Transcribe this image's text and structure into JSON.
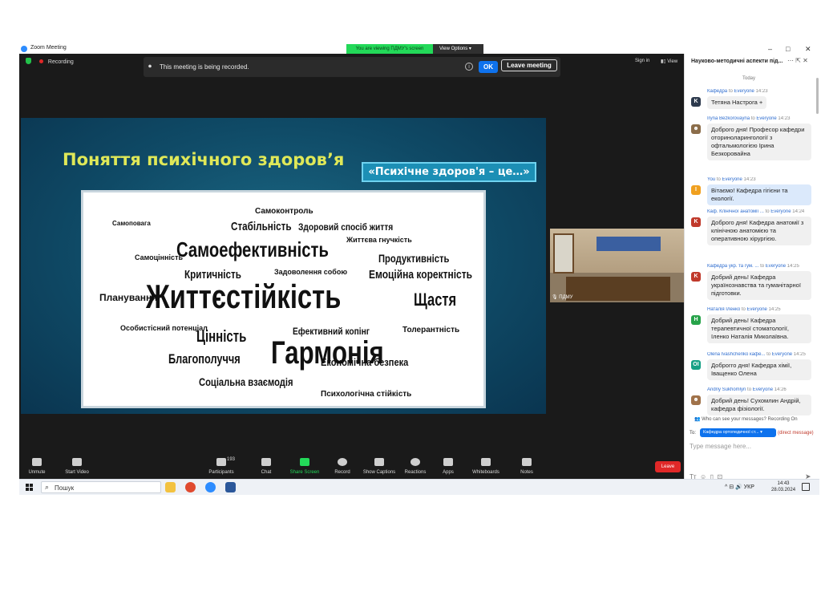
{
  "window": {
    "title": "Zoom Meeting",
    "viewing_banner": "You are viewing ПДМУ's screen",
    "view_options": "View Options",
    "controls": [
      "–",
      "□",
      "✕"
    ]
  },
  "top": {
    "recording": "Recording",
    "banner_text": "This meeting is being recorded.",
    "ok": "OK",
    "leave_meeting": "Leave meeting",
    "sign_in": "Sign in",
    "view": "View"
  },
  "slide": {
    "title": "Поняття психічного здоров’я",
    "box": "«Психічне здоров'я – це…»",
    "words": [
      "Життєстійкість",
      "Гармонія",
      "Самоефективність",
      "Щастя",
      "Цінність",
      "Благополуччя",
      "Самоконтроль",
      "Стабільність",
      "Продуктивність",
      "Емоційна коректність",
      "Критичність",
      "Соціальна взаємодія",
      "Економічна безпека",
      "Здоровий спосіб життя",
      "Ефективний копінг",
      "Толерантність",
      "Планування",
      "Психологічна стійкість",
      "Задоволення собою",
      "Самоцінність",
      "Особистісний потенціал",
      "Життєва гнучкість",
      "Самоповага"
    ]
  },
  "video": {
    "label": "ПДМУ"
  },
  "toolbar": {
    "unmute": "Unmute",
    "start_video": "Start Video",
    "participants": "Participants",
    "participants_count": "193",
    "chat": "Chat",
    "share_screen": "Share Screen",
    "record": "Record",
    "show_captions": "Show Captions",
    "reactions": "Reactions",
    "apps": "Apps",
    "whiteboards": "Whiteboards",
    "notes": "Notes",
    "leave": "Leave"
  },
  "chat": {
    "title": "Науково-методичні аспекти під...",
    "today": "Today",
    "messages": [
      {
        "from": "Кафедра",
        "to": "Everyone",
        "time": "14:23",
        "avatar": "K",
        "color": "#2d3a4d",
        "text": "Тетяна Настрога +"
      },
      {
        "from": "Iryna Bezkorovayna",
        "to": "Everyone",
        "time": "14:23",
        "avatar": "img",
        "color": "#8b6d4a",
        "text": "Доброго дня! Професор кафедри оториноларингології з офтальмологією Ірина Безкоровайна"
      },
      {
        "from": "You",
        "to": "Everyone",
        "time": "14:23",
        "avatar": "I",
        "color": "#f0a020",
        "text": "Вітаємо! Кафедра гігієни та екології."
      },
      {
        "from": "Каф. Клінічної анатомії ...",
        "to": "Everyone",
        "time": "14:24",
        "avatar": "K",
        "color": "#c0392b",
        "text": "Доброго дня! Кафедра анатомії з клінічною анатомією та оперативною хірургією."
      },
      {
        "from": "Кафедра укр. та гум. ...",
        "to": "Everyone",
        "time": "14:25",
        "avatar": "K",
        "color": "#c0392b",
        "text": "Добрий день! Кафедра українознавства та гуманітарної підготовки."
      },
      {
        "from": "Наталія Іленко",
        "to": "Everyone",
        "time": "14:25",
        "avatar": "H",
        "color": "#27a34a",
        "text": "Добрий день! Кафедра терапевтичної стоматології, Іленко Наталія Миколаївна."
      },
      {
        "from": "Olena Ivashchenko кафе...",
        "to": "Everyone",
        "time": "14:25",
        "avatar": "OI",
        "color": "#16a085",
        "text": "Доброгго дня! Кафедра хімії, Іващенко Олена"
      },
      {
        "from": "Andriy Sukhomlyn",
        "to": "Everyone",
        "time": "14:26",
        "avatar": "img",
        "color": "#a0724a",
        "text": "Добрий день! Сухомлин Андрій, кафедра фізіології."
      }
    ],
    "to_word": "to",
    "who_can_see": "Who can see your messages? Recording On",
    "to_label": "To:",
    "recipient": "Кафедра ортопедичної ст...",
    "direct": "(direct message)",
    "placeholder": "Type message here..."
  },
  "taskbar": {
    "search": "Пошук",
    "lang": "УКР",
    "time": "14:43",
    "date": "28.03.2024"
  }
}
